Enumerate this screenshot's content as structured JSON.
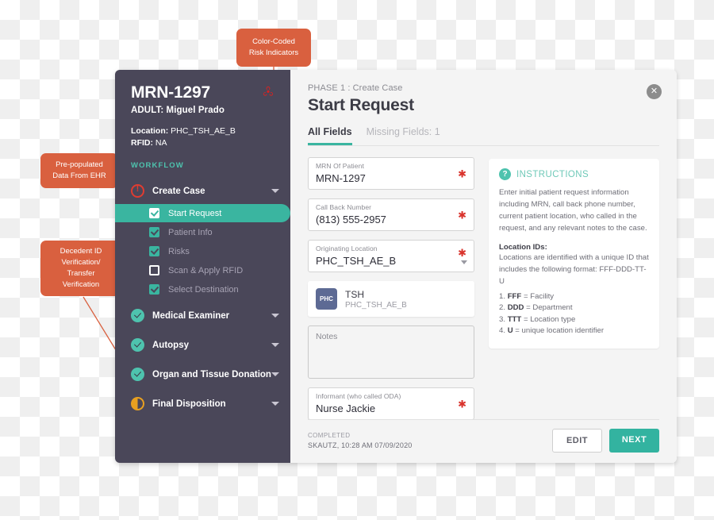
{
  "sidebar": {
    "mrn": "MRN-1297",
    "patient": "ADULT: Miguel Prado",
    "location_label": "Location:",
    "location_value": "PHC_TSH_AE_B",
    "rfid_label": "RFID:",
    "rfid_value": "NA",
    "workflow_label": "WORKFLOW",
    "biohazard_icon": "biohazard-icon",
    "groups": [
      {
        "label": "Create Case",
        "icon": "alert-circle-icon",
        "status": "alert",
        "subitems": [
          {
            "label": "Start Request",
            "checked": true,
            "active": true
          },
          {
            "label": "Patient Info",
            "checked": true,
            "active": false
          },
          {
            "label": "Risks",
            "checked": true,
            "active": false
          },
          {
            "label": "Scan & Apply RFID",
            "checked": false,
            "active": false
          },
          {
            "label": "Select Destination",
            "checked": true,
            "active": false
          }
        ]
      },
      {
        "label": "Medical Examiner",
        "icon": "check-circle-icon",
        "status": "done",
        "subitems": []
      },
      {
        "label": "Autopsy",
        "icon": "check-circle-icon",
        "status": "done",
        "subitems": []
      },
      {
        "label": "Organ and Tissue Donation",
        "icon": "check-circle-icon",
        "status": "done",
        "subitems": []
      },
      {
        "label": "Final Disposition",
        "icon": "half-circle-icon",
        "status": "partial",
        "subitems": []
      }
    ]
  },
  "main": {
    "phase": "PHASE 1 : Create Case",
    "title": "Start Request",
    "close_icon": "close-icon",
    "close_glyph": "✕",
    "tabs": [
      {
        "label": "All Fields",
        "active": true
      },
      {
        "label": "Missing Fields: 1",
        "active": false
      }
    ],
    "fields": [
      {
        "label": "MRN Of Patient",
        "value": "MRN-1297",
        "required": true,
        "type": "text"
      },
      {
        "label": "Call Back Number",
        "value": "(813) 555-2957",
        "required": true,
        "type": "text"
      },
      {
        "label": "Originating Location",
        "value": "PHC_TSH_AE_B",
        "required": true,
        "type": "select"
      }
    ],
    "location_card": {
      "badge": "PHC",
      "name": "TSH",
      "id": "PHC_TSH_AE_B"
    },
    "notes_placeholder": "Notes",
    "informant": {
      "label": "Informant (who called ODA)",
      "value": "Nurse Jackie",
      "required": true
    },
    "required_marker": "✱"
  },
  "instructions": {
    "icon": "question-mark-icon",
    "icon_glyph": "?",
    "title": "INSTRUCTIONS",
    "paragraph": "Enter initial patient request information including MRN, call back phone number, current patient location, who called in the request, and any relevant notes to the case.",
    "subheading": "Location IDs:",
    "body": "Locations are identified with a unique ID that includes the following format: FFF-DDD-TT-U",
    "list": [
      {
        "num": "1.",
        "code": "FFF",
        "desc": " = Facility"
      },
      {
        "num": "2.",
        "code": "DDD",
        "desc": " = Department"
      },
      {
        "num": "3.",
        "code": "TTT",
        "desc": " = Location type"
      },
      {
        "num": "4.",
        "code": "U",
        "desc": " = unique location identifier"
      }
    ]
  },
  "footer": {
    "status_label": "COMPLETED",
    "status_detail": "SKAUTZ, 10:28 AM 07/09/2020",
    "edit_label": "EDIT",
    "next_label": "NEXT"
  },
  "callouts": [
    {
      "id": "risk",
      "text": "Color-Coded Risk Indicators"
    },
    {
      "id": "ehr",
      "text": "Pre-populated Data From EHR"
    },
    {
      "id": "id",
      "text": "Decedent ID Verification/ Transfer Verification"
    }
  ],
  "colors": {
    "sidebar_bg": "#4a4759",
    "accent_teal": "#3ab5a0",
    "callout_orange": "#d9603f",
    "alert_red": "#e03c31",
    "partial_orange": "#e8a020",
    "badge_blue": "#5d6a94"
  }
}
